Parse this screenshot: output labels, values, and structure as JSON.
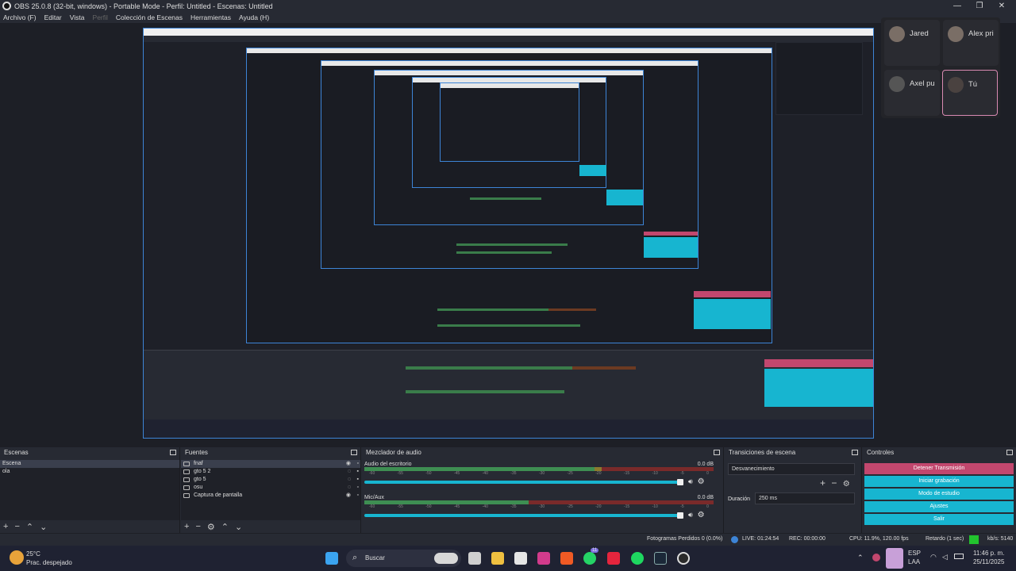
{
  "window": {
    "title": "OBS 25.0.8 (32-bit, windows) - Portable Mode - Perfil: Untitled - Escenas: Untitled",
    "minimize": "—",
    "maximize": "❐",
    "close": "✕"
  },
  "menu": [
    "Archivo (F)",
    "Editar",
    "Vista",
    "Perfil",
    "Colección de Escenas",
    "Herramientas",
    "Ayuda (H)"
  ],
  "call": {
    "participants": [
      {
        "name": "Jared",
        "selected": false
      },
      {
        "name": "Alex pri",
        "selected": false
      },
      {
        "name": "Axel pu",
        "selected": false
      },
      {
        "name": "Tú",
        "selected": true
      }
    ]
  },
  "scenes": {
    "title": "Escenas",
    "items": [
      "Escena",
      "ola"
    ],
    "selected_index": 0
  },
  "sources": {
    "title": "Fuentes",
    "items": [
      "fnaf",
      "gto 5 2",
      "gto 5",
      "osu",
      "Captura de pantalla"
    ]
  },
  "mixer": {
    "title": "Mezclador de audio",
    "channels": [
      {
        "name": "Audio del escritorio",
        "db": "0.0 dB",
        "level": 0.68
      },
      {
        "name": "Mic/Aux",
        "db": "0.0 dB",
        "level": 0.47
      }
    ],
    "scale": [
      "-60",
      "-55",
      "-50",
      "-45",
      "-40",
      "-35",
      "-30",
      "-25",
      "-20",
      "-15",
      "-10",
      "-5",
      "0"
    ]
  },
  "transitions": {
    "title": "Transiciones de escena",
    "type": "Desvanecimiento",
    "duration_label": "Duración",
    "duration_value": "250 ms"
  },
  "controls": {
    "title": "Controles",
    "buttons": [
      "Detener Transmisión",
      "Iniciar grabación",
      "Modo de estudio",
      "Ajustes",
      "Salir"
    ]
  },
  "status": {
    "dropped": "Fotogramas Perdidos 0 (0.0%)",
    "live": "LIVE: 01:24:54",
    "rec": "REC: 00:00:00",
    "cpu": "CPU: 11.9%, 120.00 fps",
    "delay": "Retardo (1 sec)",
    "kbps": "kb/s: 5140"
  },
  "taskbar": {
    "weather_temp": "25°C",
    "weather_desc": "Prac. despejado",
    "search": "Buscar",
    "lang1": "ESP",
    "lang2": "LAA",
    "time": "11:46 p. m.",
    "date": "25/11/2025",
    "badge": "11"
  },
  "colors": {
    "accent": "#17b5d0",
    "stop": "#c2476e",
    "live_dot": "#3d84d6",
    "green": "#22c32e"
  }
}
